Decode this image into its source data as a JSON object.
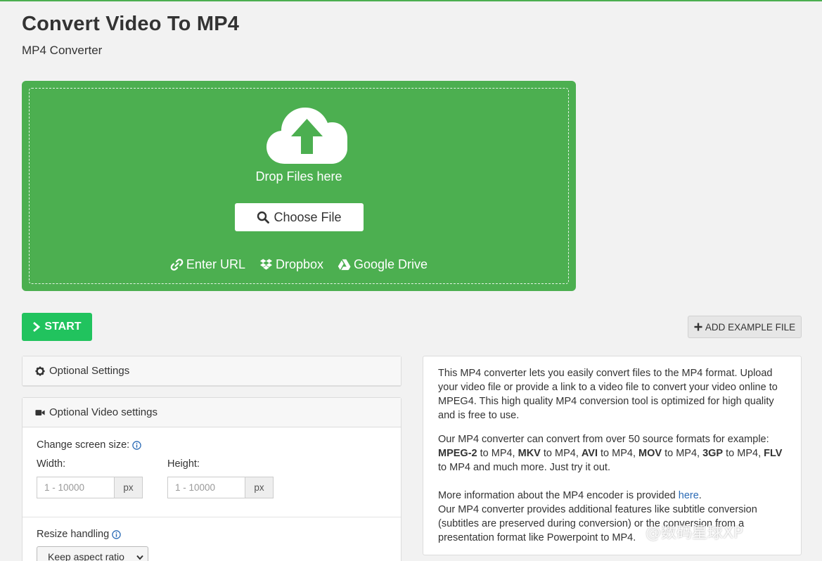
{
  "page": {
    "title": "Convert Video To MP4",
    "subtitle": "MP4 Converter"
  },
  "dropzone": {
    "drop_text": "Drop Files here",
    "choose_label": "Choose File",
    "sources": [
      {
        "label": "Enter URL",
        "icon": "link-icon"
      },
      {
        "label": "Dropbox",
        "icon": "dropbox-icon"
      },
      {
        "label": "Google Drive",
        "icon": "google-drive-icon"
      }
    ],
    "bg_color": "#4caf50"
  },
  "actions": {
    "start_label": "START",
    "example_label": "ADD EXAMPLE FILE",
    "start_color": "#21c35e"
  },
  "optional_settings": {
    "label": "Optional Settings"
  },
  "video_settings": {
    "label": "Optional Video settings",
    "screen_size_label": "Change screen size:",
    "width_label": "Width:",
    "height_label": "Height:",
    "width_placeholder": "1 - 10000",
    "height_placeholder": "1 - 10000",
    "unit": "px",
    "resize_label": "Resize handling",
    "resize_value": "Keep aspect ratio"
  },
  "info": {
    "p1": "This MP4 converter lets you easily convert files to the MP4 format. Upload your video file or provide a link to a video file to convert your video online to MPEG4. This high quality MP4 conversion tool is optimized for high quality and is free to use.",
    "p2_intro": "Our MP4 converter can convert from over 50 source formats for example: ",
    "formats": [
      "MPEG-2",
      "MKV",
      "AVI",
      "MOV",
      "3GP",
      "FLV"
    ],
    "to_mp4": " to MP4, ",
    "to_mp4_last": " to ",
    "p2_end": "MP4 and much more. Just try it out.",
    "p3_pre": "More information about the MP4 encoder is provided ",
    "p3_link": "here",
    "p3_post": ".",
    "p4": "Our MP4 converter provides additional features like subtitle conversion (subtitles are preserved during conversion) or the conversion from a presentation format like Powerpoint to MP4."
  },
  "watermark": "@数码星球XP"
}
